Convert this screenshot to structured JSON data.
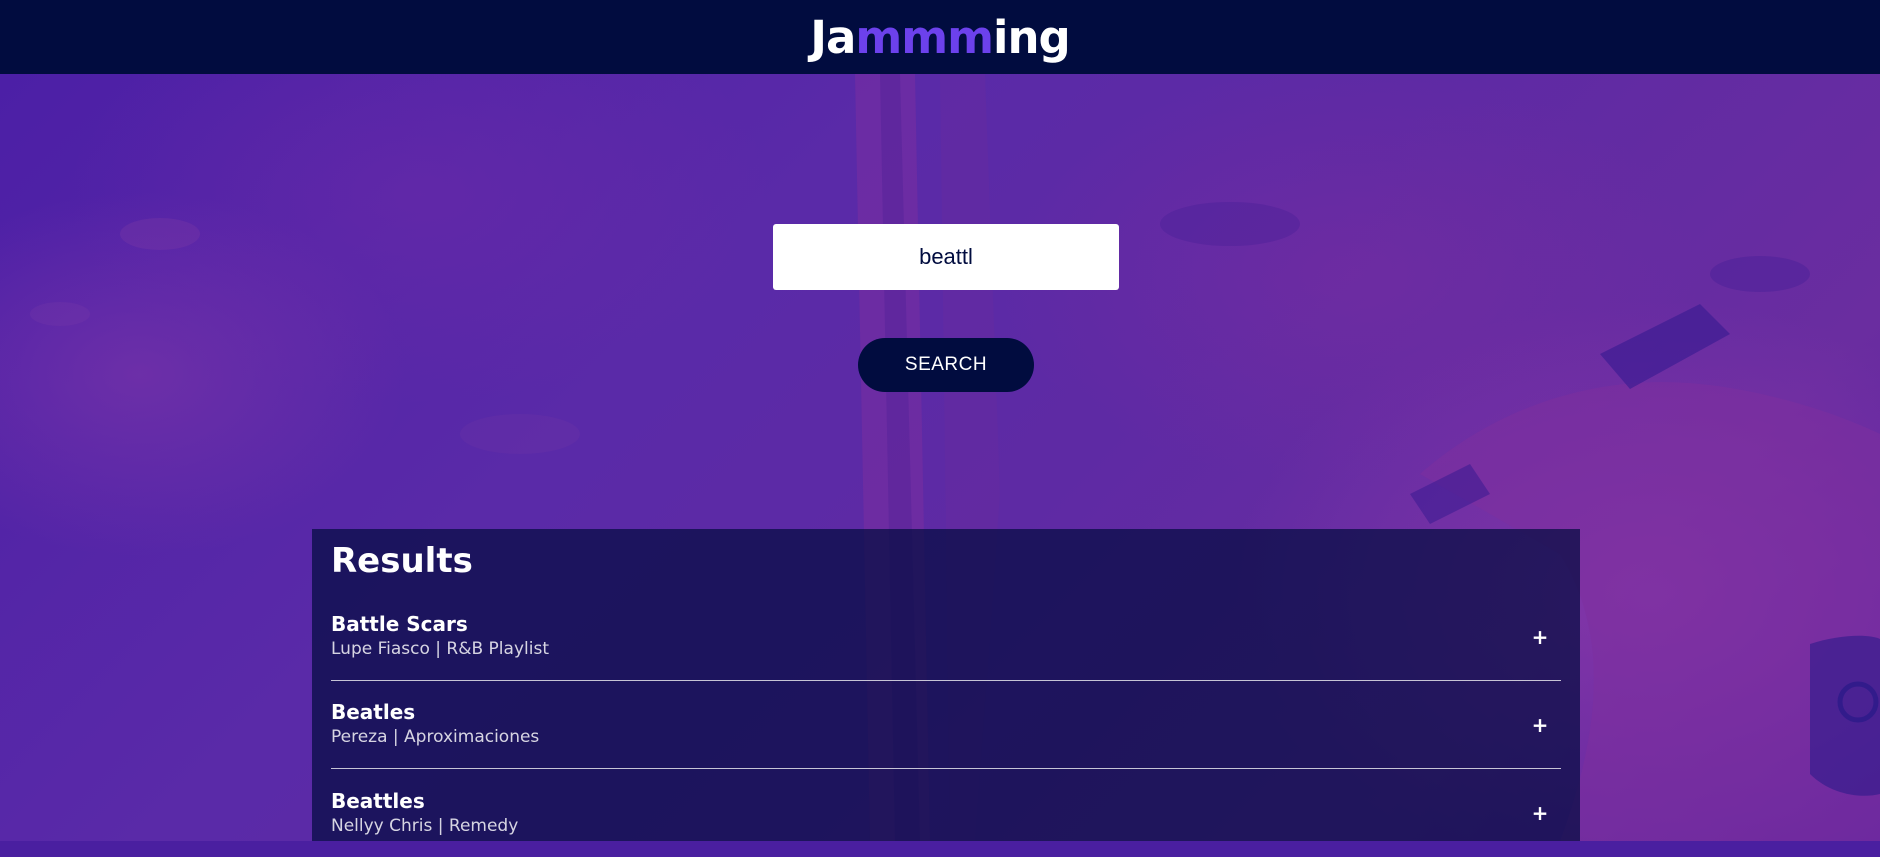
{
  "header": {
    "logo_part1": "Ja",
    "logo_part2": "mmm",
    "logo_part3": "ing",
    "logo_accent_color": "#6c41ec",
    "background_color": "#010c3f"
  },
  "search": {
    "value": "beattl",
    "button_label": "SEARCH"
  },
  "results": {
    "title": "Results",
    "tracks": [
      {
        "name": "Battle Scars",
        "meta": "Lupe Fiasco | R&B Playlist",
        "action": "+",
        "action_icon": "plus-icon"
      },
      {
        "name": "Beatles",
        "meta": "Pereza | Aproximaciones",
        "action": "+",
        "action_icon": "plus-icon"
      },
      {
        "name": "Beattles",
        "meta": "Nellyy Chris | Remedy",
        "action": "+",
        "action_icon": "plus-icon"
      }
    ]
  },
  "colors": {
    "background_purple": "#5a2aa8",
    "navy": "#010c3f",
    "white": "#ffffff"
  }
}
